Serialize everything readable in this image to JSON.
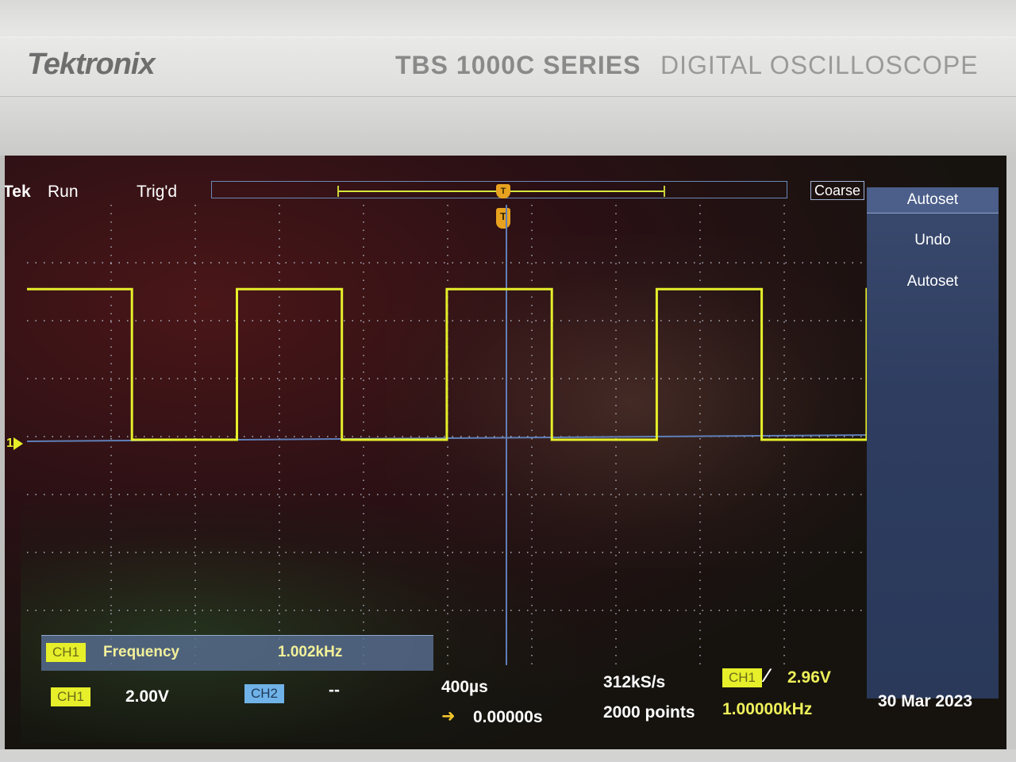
{
  "bezel": {
    "brand": "Tektronix",
    "series": "TBS 1000C SERIES",
    "subtitle": "DIGITAL OSCILLOSCOPE"
  },
  "status_bar": {
    "logo": "Tek",
    "run_state": "Run",
    "trigger_state": "Trig'd",
    "knob_mode": "Coarse"
  },
  "side_menu": {
    "title": "Autoset",
    "items": [
      "Undo",
      "Autoset"
    ]
  },
  "measurement": {
    "channel": "CH1",
    "label": "Frequency",
    "value": "1.002kHz"
  },
  "channels": {
    "ch1": {
      "label": "CH1",
      "scale": "2.00V"
    },
    "ch2": {
      "label": "CH2",
      "scale": "--"
    }
  },
  "timebase": {
    "scale": "400µs",
    "position": "0.00000s",
    "sample_rate": "312kS/s",
    "record_length": "2000 points"
  },
  "trigger": {
    "source": "CH1",
    "level": "2.96V",
    "frequency": "1.00000kHz",
    "marker": "T"
  },
  "ground_marker": "1",
  "date": "30 Mar 2023",
  "colors": {
    "ch1": "#e6ef2a",
    "ch2": "#6fb3e8",
    "trigger": "#e8a21f",
    "menu": "#2e3d60"
  },
  "waveform": {
    "type": "square",
    "frequency_hz": 1002,
    "duty_cycle": 0.5,
    "volts_per_div": 2.0,
    "sec_per_div": 0.0004,
    "low_volts": 0,
    "high_volts": 5.2
  }
}
